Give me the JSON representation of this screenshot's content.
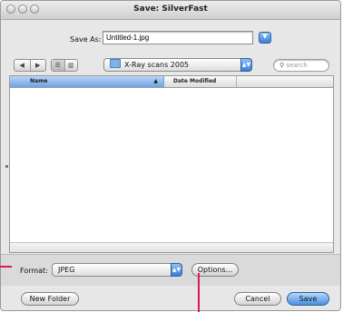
{
  "window": {
    "title": "Save: SilverFast"
  },
  "save_as": {
    "label": "Save As:",
    "value": "Untitled-1.jpg"
  },
  "browser": {
    "nav_back": "◀",
    "nav_forward": "▶",
    "view_list": "☰",
    "view_columns": "▥",
    "location": "X-Ray scans 2005",
    "search_placeholder": "search"
  },
  "file_list": {
    "columns": [
      "Name",
      "Date Modified"
    ],
    "sort_indicator": "▲",
    "rows": []
  },
  "format": {
    "label": "Format:",
    "value": "JPEG"
  },
  "buttons": {
    "options": "Options...",
    "new_folder": "New Folder",
    "cancel": "Cancel",
    "save": "Save"
  },
  "colors": {
    "callout": "#d8175f",
    "accent_blue": "#3b7fd8"
  },
  "icons": {
    "expand": "triangle-down-icon",
    "popup_arrows": "updown-arrows-icon",
    "folder": "folder-icon",
    "search": "magnifier-icon"
  }
}
